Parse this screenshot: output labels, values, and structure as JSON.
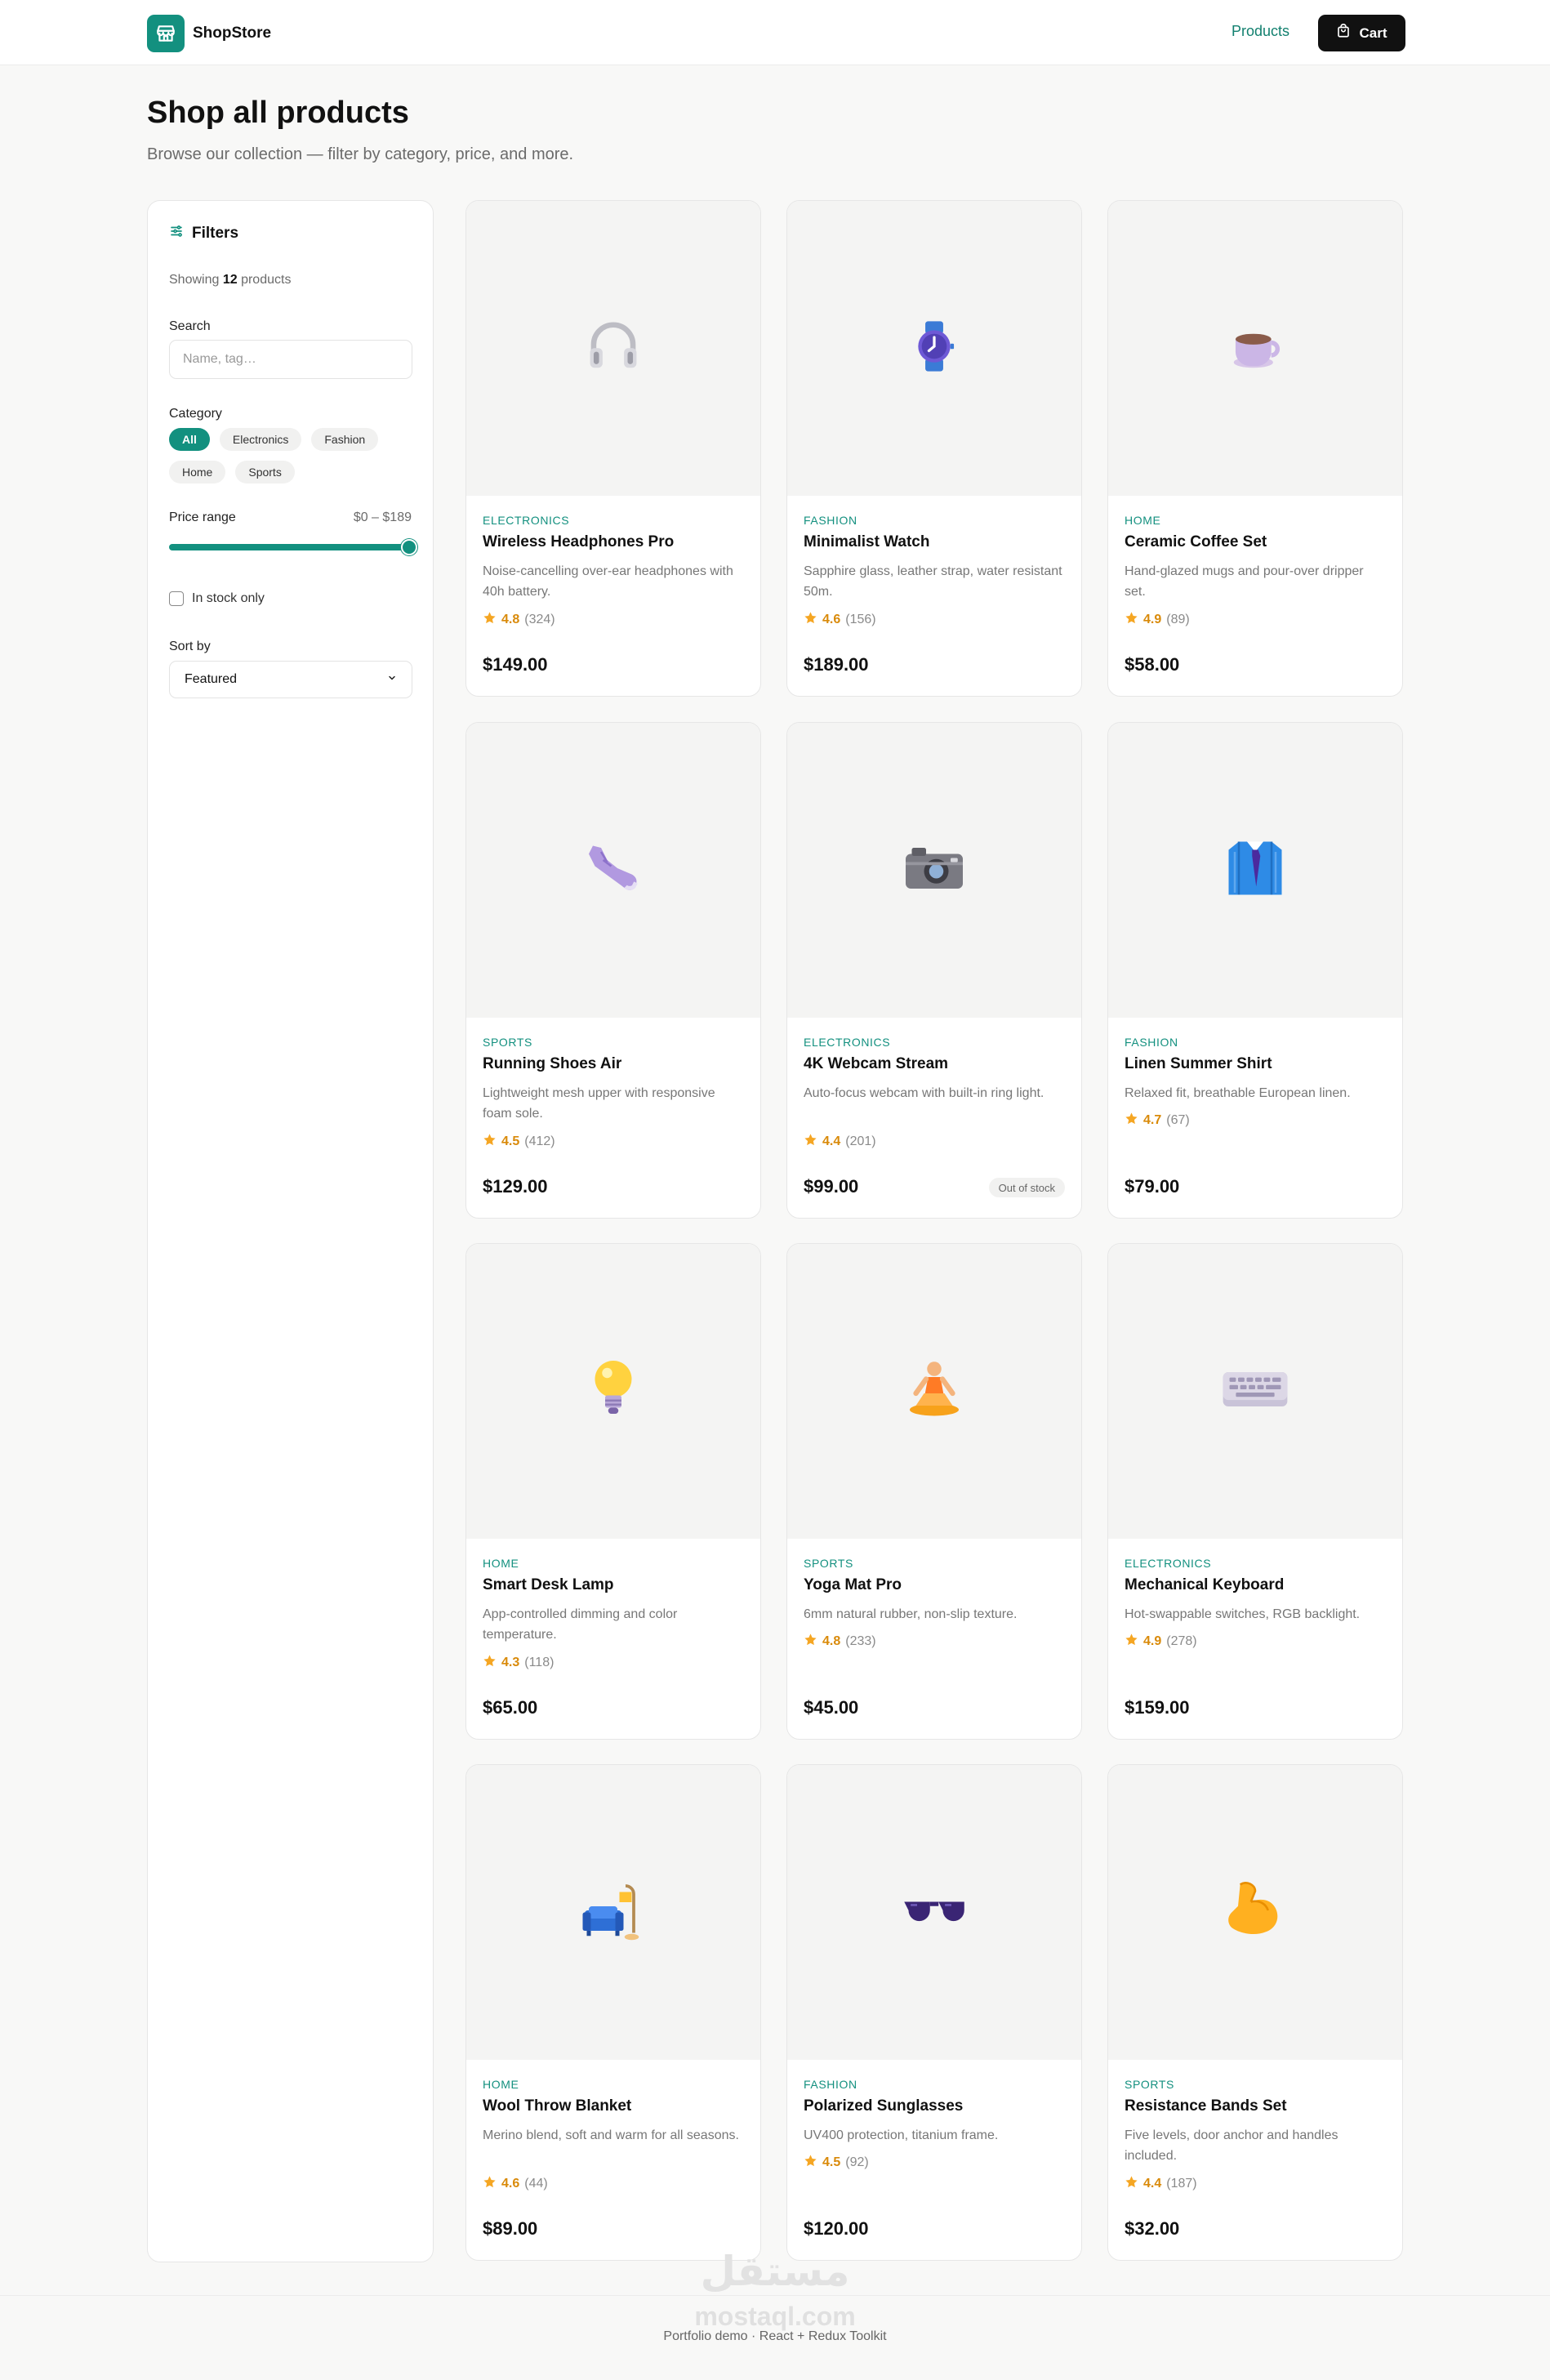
{
  "header": {
    "brand": "ShopStore",
    "nav_products": "Products",
    "cart_label": "Cart"
  },
  "page": {
    "title": "Shop all products",
    "subtitle": "Browse our collection — filter by category, price, and more."
  },
  "filters": {
    "title": "Filters",
    "showing_prefix": "Showing",
    "showing_count": "12",
    "showing_suffix": "products",
    "search_label": "Search",
    "search_placeholder": "Name, tag…",
    "category_label": "Category",
    "categories": [
      "All",
      "Electronics",
      "Fashion",
      "Home",
      "Sports"
    ],
    "active_category": "All",
    "price_label": "Price range",
    "price_value": "$0 – $189",
    "price_fill_fraction": 1.0,
    "in_stock_label": "In stock only",
    "in_stock_checked": false,
    "sort_label": "Sort by",
    "sort_value": "Featured"
  },
  "colors": {
    "accent": "#13907f",
    "rating": "#f5a623",
    "dark": "#111111"
  },
  "products": [
    {
      "category": "ELECTRONICS",
      "name": "Wireless Headphones Pro",
      "desc": "Noise-cancelling over-ear headphones with 40h battery.",
      "rating": "4.8",
      "count": "(324)",
      "price": "$149.00",
      "icon": "headphones-icon",
      "oos": ""
    },
    {
      "category": "FASHION",
      "name": "Minimalist Watch",
      "desc": "Sapphire glass, leather strap, water resistant 50m.",
      "rating": "4.6",
      "count": "(156)",
      "price": "$189.00",
      "icon": "watch-icon",
      "oos": ""
    },
    {
      "category": "HOME",
      "name": "Ceramic Coffee Set",
      "desc": "Hand-glazed mugs and pour-over dripper set.",
      "rating": "4.9",
      "count": "(89)",
      "price": "$58.00",
      "icon": "coffee-icon",
      "oos": ""
    },
    {
      "category": "SPORTS",
      "name": "Running Shoes Air",
      "desc": "Lightweight mesh upper with responsive foam sole.",
      "rating": "4.5",
      "count": "(412)",
      "price": "$129.00",
      "icon": "shoe-icon",
      "oos": ""
    },
    {
      "category": "ELECTRONICS",
      "name": "4K Webcam Stream",
      "desc": "Auto-focus webcam with built-in ring light.",
      "rating": "4.4",
      "count": "(201)",
      "price": "$99.00",
      "icon": "camera-icon",
      "oos": "Out of stock"
    },
    {
      "category": "FASHION",
      "name": "Linen Summer Shirt",
      "desc": "Relaxed fit, breathable European linen.",
      "rating": "4.7",
      "count": "(67)",
      "price": "$79.00",
      "icon": "shirt-icon",
      "oos": ""
    },
    {
      "category": "HOME",
      "name": "Smart Desk Lamp",
      "desc": "App-controlled dimming and color temperature.",
      "rating": "4.3",
      "count": "(118)",
      "price": "$65.00",
      "icon": "light-bulb-icon",
      "oos": ""
    },
    {
      "category": "SPORTS",
      "name": "Yoga Mat Pro",
      "desc": "6mm natural rubber, non-slip texture.",
      "rating": "4.8",
      "count": "(233)",
      "price": "$45.00",
      "icon": "yoga-icon",
      "oos": ""
    },
    {
      "category": "ELECTRONICS",
      "name": "Mechanical Keyboard",
      "desc": "Hot-swappable switches, RGB backlight.",
      "rating": "4.9",
      "count": "(278)",
      "price": "$159.00",
      "icon": "keyboard-icon",
      "oos": ""
    },
    {
      "category": "HOME",
      "name": "Wool Throw Blanket",
      "desc": "Merino blend, soft and warm for all seasons.",
      "rating": "4.6",
      "count": "(44)",
      "price": "$89.00",
      "icon": "couch-lamp-icon",
      "oos": ""
    },
    {
      "category": "FASHION",
      "name": "Polarized Sunglasses",
      "desc": "UV400 protection, titanium frame.",
      "rating": "4.5",
      "count": "(92)",
      "price": "$120.00",
      "icon": "sunglasses-icon",
      "oos": ""
    },
    {
      "category": "SPORTS",
      "name": "Resistance Bands Set",
      "desc": "Five levels, door anchor and handles included.",
      "rating": "4.4",
      "count": "(187)",
      "price": "$32.00",
      "icon": "flexed-bicep-icon",
      "oos": ""
    }
  ],
  "footer": {
    "watermark": "مستقل",
    "watermark_latin": "mostaql.com",
    "text": "Portfolio demo · React + Redux Toolkit"
  }
}
